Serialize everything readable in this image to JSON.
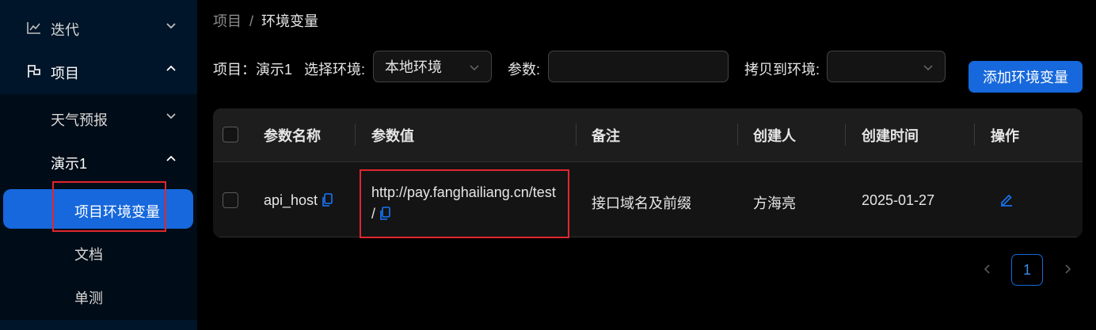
{
  "sidebar": {
    "items": [
      {
        "label": "迭代"
      },
      {
        "label": "项目"
      }
    ],
    "sub_items": [
      {
        "label": "天气预报"
      },
      {
        "label": "演示1"
      },
      {
        "label": "项目环境变量"
      },
      {
        "label": "文档"
      },
      {
        "label": "单测"
      }
    ]
  },
  "breadcrumb": {
    "parent": "项目",
    "separator": "/",
    "current": "环境变量"
  },
  "filters": {
    "project_label": "项目：演示1",
    "env_label": "选择环境:",
    "env_value": "本地环境",
    "param_label": "参数:",
    "param_value": "",
    "copy_label": "拷贝到环境:",
    "copy_value": ""
  },
  "actions": {
    "add_label": "添加环境变量"
  },
  "table": {
    "headers": [
      "参数名称",
      "参数值",
      "备注",
      "创建人",
      "创建时间",
      "操作"
    ],
    "rows": [
      {
        "name": "api_host",
        "value_line1": "http://pay.fanghailiang.cn/test",
        "value_line2": "/",
        "note": "接口域名及前缀",
        "creator": "方海亮",
        "created_at": "2025-01-27"
      }
    ]
  },
  "pagination": {
    "current": "1"
  },
  "colors": {
    "accent": "#1668dc",
    "highlight_box": "#e0262f",
    "sidebar_bg": "#001529"
  }
}
